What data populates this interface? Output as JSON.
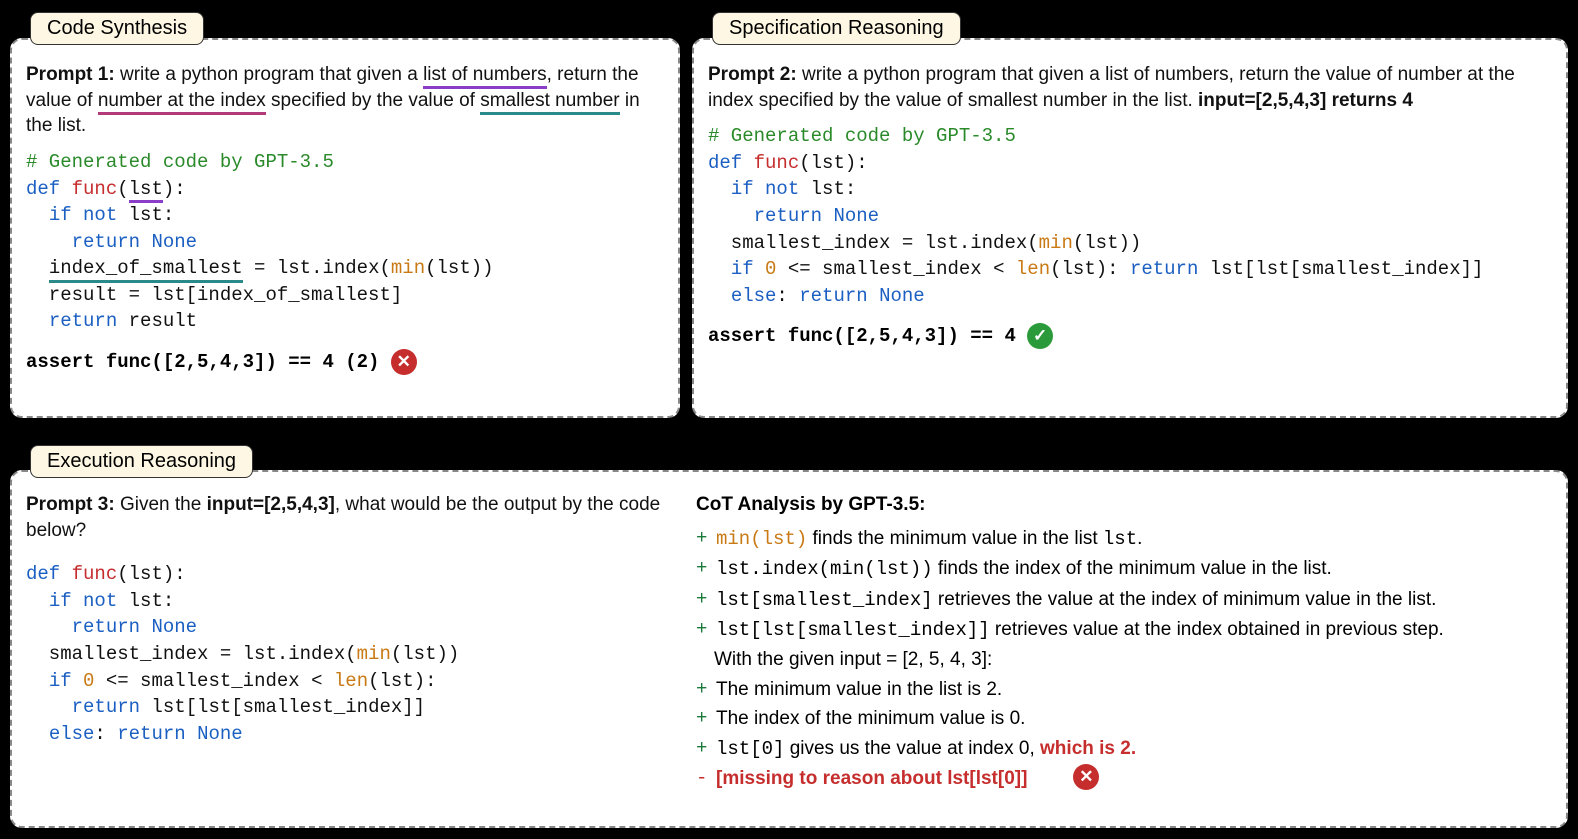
{
  "tabs": {
    "code_synth": "Code Synthesis",
    "spec_reason": "Specification Reasoning",
    "exec_reason": "Execution Reasoning"
  },
  "panel1": {
    "prompt_label": "Prompt 1:",
    "prompt_pre": " write a python program that given a ",
    "u_purple": "list of numbers",
    "prompt_mid1": ", return the value of ",
    "u_magenta": "number at the index",
    "prompt_mid2": " specified by the value of ",
    "u_teal": "smallest number",
    "prompt_post": " in the list.",
    "comment": "# Generated code by GPT-3.5",
    "assert": "assert func([2,5,4,3]) == 4 (2)"
  },
  "panel2": {
    "prompt_label": "Prompt 2:",
    "prompt_body": " write a python program that given a list of numbers, return the value of number at the index specified by the value of smallest number in the list. ",
    "prompt_bold": "input=[2,5,4,3] returns 4",
    "comment": "# Generated code by GPT-3.5",
    "assert": "assert func([2,5,4,3]) == 4"
  },
  "panel3": {
    "prompt_label": "Prompt 3:",
    "prompt_pre": " Given the ",
    "prompt_bold": "input=[2,5,4,3]",
    "prompt_post": ", what would be the output by the code below?"
  },
  "cot": {
    "title": "CoT Analysis by GPT-3.5:",
    "l1_code": "min(lst)",
    "l1_rest": " finds the minimum value in the list ",
    "l1_code2": "lst",
    "l1_end": ".",
    "l2_code": "lst.index(min(lst))",
    "l2_rest": " finds the index of the minimum value in the list.",
    "l3_code": "lst[smallest_index]",
    "l3_rest": " retrieves the value at the index of minimum value in the list.",
    "l4_code": "lst[lst[smallest_index]]",
    "l4_rest": " retrieves value at the index obtained in previous step.",
    "l5": "With the given input = [2, 5, 4, 3]:",
    "l6": "The minimum value in the list is 2.",
    "l7": "The index of the minimum value is 0.",
    "l8_code": "lst[0]",
    "l8_rest": " gives us the value at index 0, ",
    "l8_bold": "which is 2.",
    "l9": "[missing to reason about lst[lst[0]]"
  }
}
